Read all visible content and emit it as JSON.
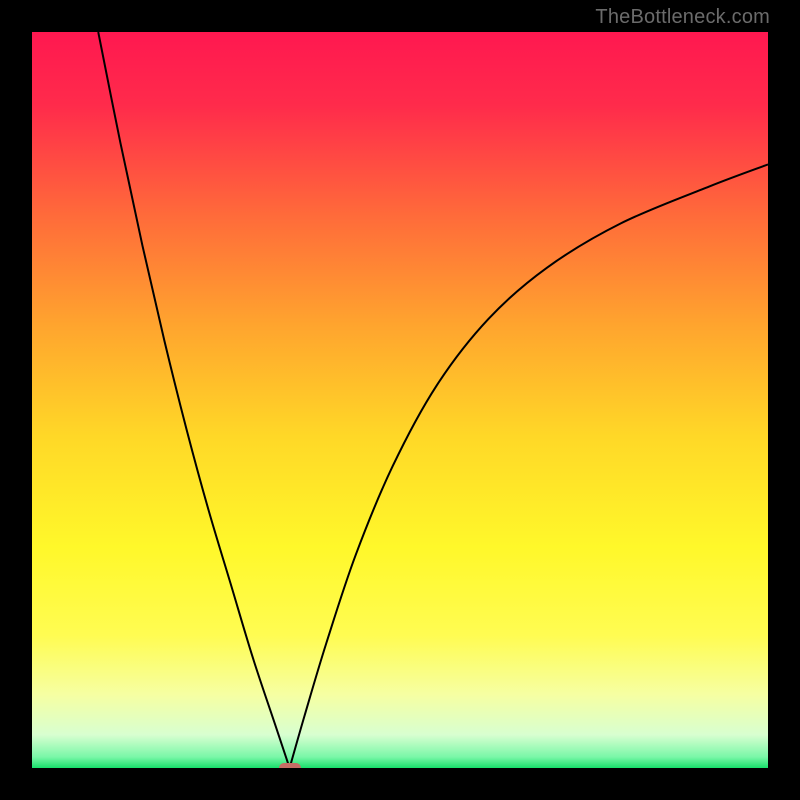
{
  "watermark": "TheBottleneck.com",
  "colors": {
    "frame": "#000000",
    "watermark": "#6b6b6b",
    "curve": "#000000",
    "marker": "#c66d65",
    "gradient_stops": [
      {
        "offset": 0.0,
        "color": "#ff1850"
      },
      {
        "offset": 0.1,
        "color": "#ff2b4b"
      },
      {
        "offset": 0.25,
        "color": "#ff6b3a"
      },
      {
        "offset": 0.4,
        "color": "#ffa52e"
      },
      {
        "offset": 0.55,
        "color": "#ffd827"
      },
      {
        "offset": 0.7,
        "color": "#fff82a"
      },
      {
        "offset": 0.82,
        "color": "#fffc52"
      },
      {
        "offset": 0.9,
        "color": "#f6ffa2"
      },
      {
        "offset": 0.955,
        "color": "#d8ffd0"
      },
      {
        "offset": 0.985,
        "color": "#7af7a8"
      },
      {
        "offset": 1.0,
        "color": "#18e06b"
      }
    ]
  },
  "chart_data": {
    "type": "line",
    "title": "",
    "xlabel": "",
    "ylabel": "",
    "xlim": [
      0,
      100
    ],
    "ylim": [
      0,
      100
    ],
    "marker": {
      "x": 35,
      "y": 0,
      "width_pct": 3.0,
      "height_pct": 1.4
    },
    "series": [
      {
        "name": "left-branch",
        "x": [
          9,
          12,
          15,
          18,
          21,
          24,
          27,
          30,
          33,
          35
        ],
        "y": [
          100,
          85,
          71,
          58,
          46,
          35,
          25,
          15,
          6,
          0
        ]
      },
      {
        "name": "right-branch",
        "x": [
          35,
          37,
          40,
          44,
          49,
          55,
          62,
          70,
          80,
          92,
          100
        ],
        "y": [
          0,
          7,
          17,
          29,
          41,
          52,
          61,
          68,
          74,
          79,
          82
        ]
      }
    ]
  }
}
